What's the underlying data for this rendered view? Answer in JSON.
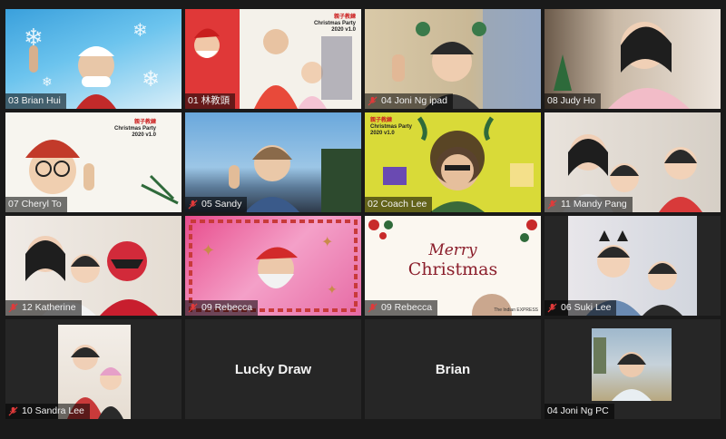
{
  "participants": [
    {
      "name": "03 Brian Hui",
      "muted": false
    },
    {
      "name": "01 林教頭",
      "muted": false
    },
    {
      "name": "04 Joni Ng ipad",
      "muted": true
    },
    {
      "name": "08 Judy Ho",
      "muted": false
    },
    {
      "name": "07 Cheryl To",
      "muted": false
    },
    {
      "name": "05 Sandy",
      "muted": true
    },
    {
      "name": "02 Coach Lee",
      "muted": false
    },
    {
      "name": "11 Mandy Pang",
      "muted": true
    },
    {
      "name": "12 Katherine",
      "muted": true
    },
    {
      "name": "09 Rebecca",
      "muted": true
    },
    {
      "name": "09 Rebecca",
      "muted": true
    },
    {
      "name": "06 Suki Lee",
      "muted": true
    },
    {
      "name": "10 Sandra Lee",
      "muted": true
    },
    {
      "name": "Lucky Draw",
      "muted": false
    },
    {
      "name": "Brian",
      "muted": false
    },
    {
      "name": "04 Joni Ng PC",
      "muted": false
    }
  ],
  "backgrounds": {
    "party_banner_org": "親子教練",
    "party_banner_title": "Christmas Party",
    "party_banner_version": "2020 v1.0",
    "merry_line1": "Merry",
    "merry_line2": "Christmas",
    "watermark": "The Indian EXPRESS"
  },
  "colors": {
    "active_speaker_border": "#e6d96a",
    "muted_icon": "#e03a3a",
    "background": "#1a1a1a"
  }
}
